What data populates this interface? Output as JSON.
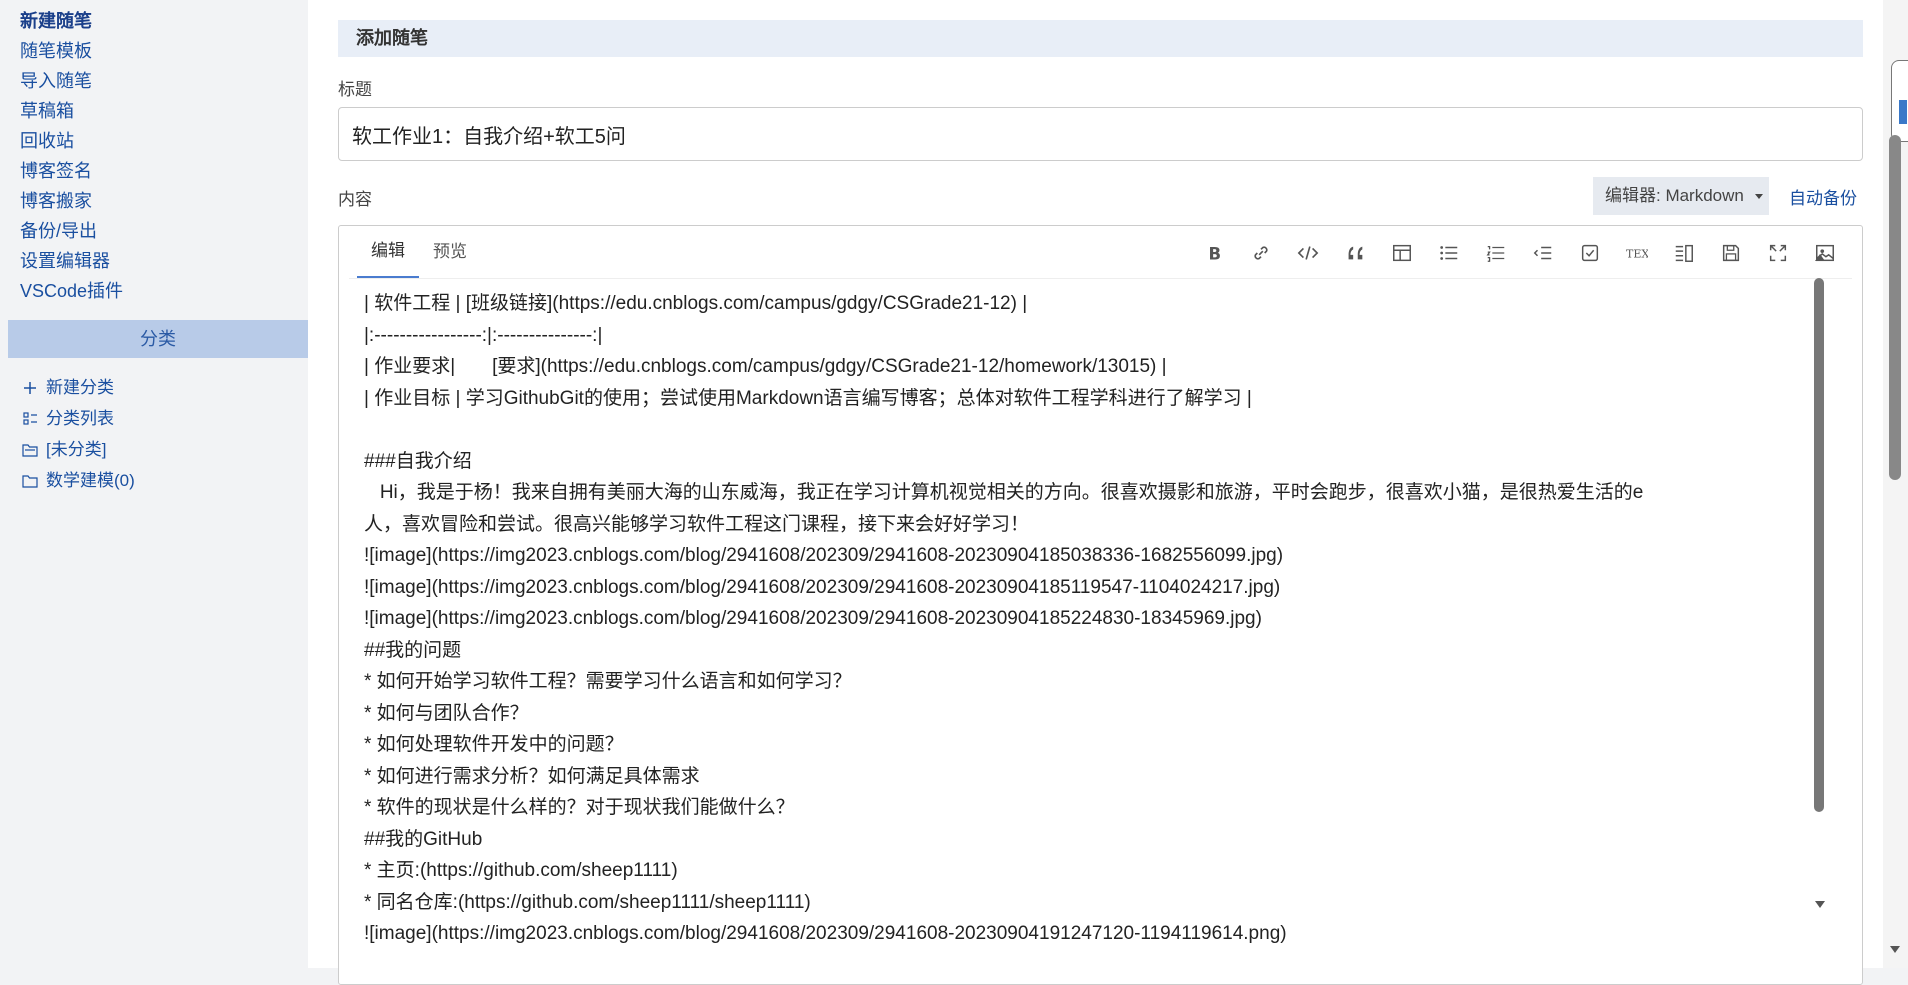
{
  "sidebar": {
    "links": [
      "新建随笔",
      "随笔模板",
      "导入随笔",
      "草稿箱",
      "回收站",
      "博客签名",
      "博客搬家",
      "备份/导出",
      "设置编辑器",
      "VSCode插件"
    ],
    "category_header": "分类",
    "categories": [
      "新建分类",
      "分类列表",
      "[未分类]",
      "数学建模(0)"
    ]
  },
  "main": {
    "section_title": "添加随笔",
    "title_label": "标题",
    "title_value": "软工作业1：自我介绍+软工5问",
    "content_label": "内容",
    "editor_select": "编辑器: Markdown",
    "autosave": "自动备份",
    "tabs": [
      "编辑",
      "预览"
    ],
    "toolbar_icons": [
      "bold-icon",
      "link-icon",
      "code-icon",
      "quote-icon",
      "table-icon",
      "bulleted-list-icon",
      "numbered-list-icon",
      "indent-icon",
      "checkbox-icon",
      "tex-icon",
      "columns-icon",
      "save-icon",
      "fullscreen-icon",
      "image-icon"
    ],
    "content_lines": [
      "| 软件工程 | [班级链接](https://edu.cnblogs.com/campus/gdgy/CSGrade21-12) |",
      "|:-----------------:|:---------------:|",
      "| 作业要求|       [要求](https://edu.cnblogs.com/campus/gdgy/CSGrade21-12/homework/13015) |",
      "| 作业目标 | 学习GithubGit的使用；尝试使用Markdown语言编写博客；总体对软件工程学科进行了解学习 |",
      "",
      "###自我介绍",
      "   Hi，我是于杨！我来自拥有美丽大海的山东威海，我正在学习计算机视觉相关的方向。很喜欢摄影和旅游，平时会跑步，很喜欢小猫，是很热爱生活的e",
      "人，喜欢冒险和尝试。很高兴能够学习软件工程这门课程，接下来会好好学习！",
      "![image](https://img2023.cnblogs.com/blog/2941608/202309/2941608-20230904185038336-1682556099.jpg)",
      "![image](https://img2023.cnblogs.com/blog/2941608/202309/2941608-20230904185119547-1104024217.jpg)",
      "![image](https://img2023.cnblogs.com/blog/2941608/202309/2941608-20230904185224830-18345969.jpg)",
      "##我的问题",
      "* 如何开始学习软件工程？需要学习什么语言和如何学习？",
      "* 如何与团队合作？",
      "* 如何处理软件开发中的问题？",
      "* 如何进行需求分析？如何满足具体需求",
      "* 软件的现状是什么样的？对于现状我们能做什么？",
      "##我的GitHub",
      "* 主页:(https://github.com/sheep1111)",
      "* 同名仓库:(https://github.com/sheep1111/sheep1111)",
      "![image](https://img2023.cnblogs.com/blog/2941608/202309/2941608-20230904191247120-1194119614.png)"
    ]
  }
}
